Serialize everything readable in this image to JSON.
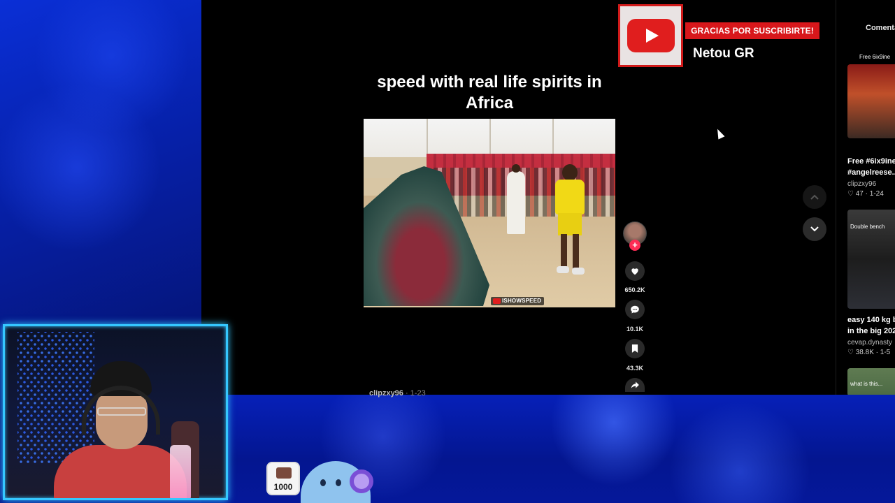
{
  "video": {
    "title": "speed with real life spirits in Africa",
    "watermark": "ISHOWSPEED",
    "author": "clipzxy96",
    "date": "1-23"
  },
  "actions": {
    "likes": "650.2K",
    "comments": "10.1K",
    "saves": "43.3K",
    "follow_symbol": "+"
  },
  "subscribe_overlay": {
    "banner": "GRACIAS POR SUSCRIBIRTE!",
    "subscriber_name": "Netou GR"
  },
  "right_panel": {
    "tab_label": "Comenta",
    "items": [
      {
        "thumb_caption": "Free 6ix9ine",
        "title_line1": "Free #6ix9ine",
        "title_line2": "#angelreese...",
        "user": "clipzxy96",
        "stats": "♡ 47 · 1-24"
      },
      {
        "thumb_caption": "Double bench",
        "title_line1": "easy 140 kg b",
        "title_line2": "in the big 202",
        "user": "cevap.dynasty",
        "stats": "♡ 38.8K · 1-5"
      },
      {
        "thumb_caption": "what is this...",
        "title_line1": "",
        "title_line2": "",
        "user": "",
        "stats": ""
      }
    ]
  },
  "stream_overlay": {
    "counter_value": "1000"
  },
  "colors": {
    "accent_red": "#d8171b",
    "tiktok_pink": "#fe2c55",
    "overlay_blue": "#0a2fd6",
    "webcam_border": "#35c7ff"
  }
}
